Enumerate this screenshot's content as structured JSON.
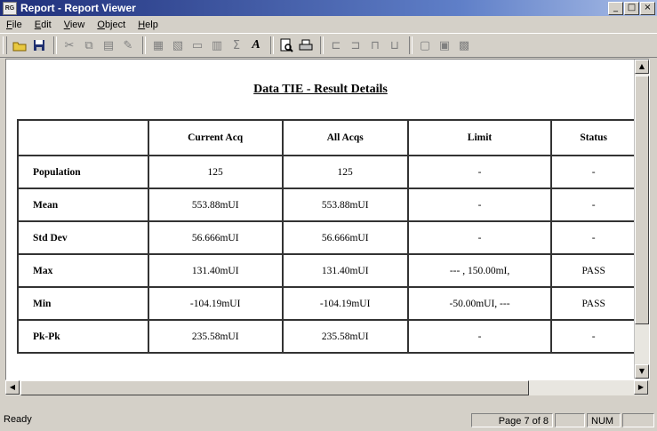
{
  "window": {
    "title": "Report - Report Viewer",
    "icon_text": "RG"
  },
  "menu": [
    "File",
    "Edit",
    "View",
    "Object",
    "Help"
  ],
  "toolbar": {
    "buttons": [
      "open-icon",
      "save-icon",
      "cut-icon",
      "copy-icon",
      "paste-icon",
      "edit-icon",
      "field-icon",
      "field-2-icon",
      "box-icon",
      "chart-icon",
      "sum-icon",
      "font-icon",
      "print-preview-icon",
      "print-icon",
      "align-left-icon",
      "align-center-icon",
      "align-right-icon",
      "align-justify-icon",
      "grid-icon",
      "snap-icon",
      "group-icon"
    ]
  },
  "report": {
    "title": "Data TIE - Result Details",
    "columns": [
      "",
      "Current Acq",
      "All Acqs",
      "Limit",
      "Status"
    ],
    "rows": [
      {
        "label": "Population",
        "current": "125",
        "all": "125",
        "limit": "-",
        "status": "-"
      },
      {
        "label": "Mean",
        "current": "553.88mUI",
        "all": "553.88mUI",
        "limit": "-",
        "status": "-"
      },
      {
        "label": "Std Dev",
        "current": "56.666mUI",
        "all": "56.666mUI",
        "limit": "-",
        "status": "-"
      },
      {
        "label": "Max",
        "current": "131.40mUI",
        "all": "131.40mUI",
        "limit": "---   , 150.00mI,",
        "status": "PASS"
      },
      {
        "label": "Min",
        "current": "-104.19mUI",
        "all": "-104.19mUI",
        "limit": "-50.00mUI,   ---",
        "status": "PASS"
      },
      {
        "label": "Pk-Pk",
        "current": "235.58mUI",
        "all": "235.58mUI",
        "limit": "-",
        "status": "-"
      }
    ]
  },
  "status": {
    "text": "Ready",
    "page": "Page 7 of 8",
    "num": "NUM"
  }
}
